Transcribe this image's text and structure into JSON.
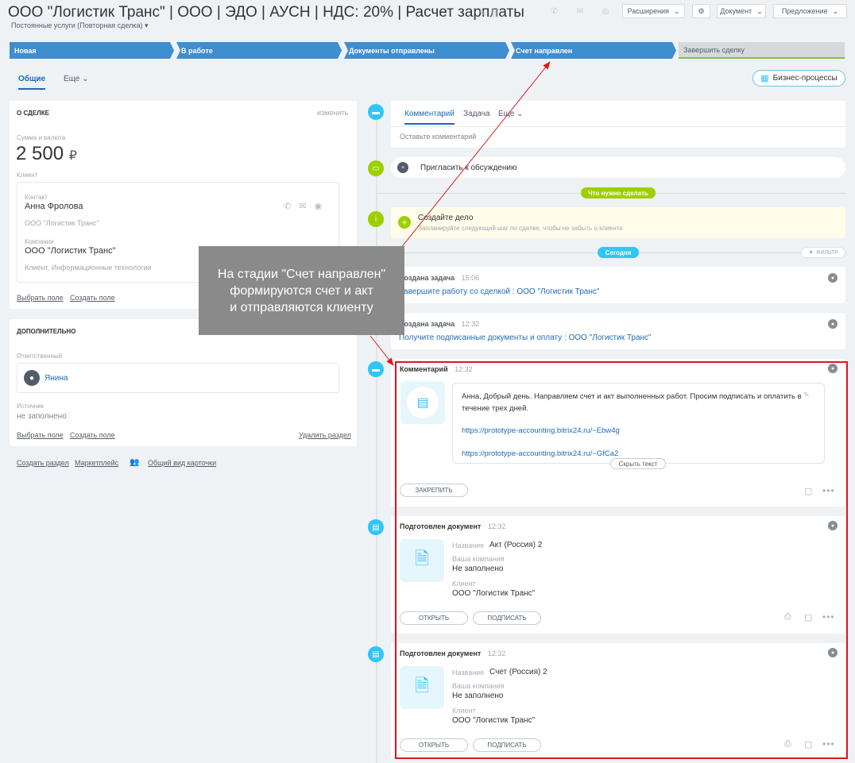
{
  "header": {
    "title": "ООО \"Логистик Транс\" | ООО | ЭДО | АУСН | НДС: 20% | Расчет зарплаты",
    "subtitle": "Постоянные услуги (Повторная сделка)",
    "extensions_label": "Расширения",
    "document_label": "Документ",
    "proposal_label": "Предложение"
  },
  "stages": [
    "Новая",
    "В работе",
    "Документы отправлены",
    "Счет направлен",
    "Завершить сделку"
  ],
  "tabs": {
    "general": "Общие",
    "more": "Еще"
  },
  "business_processes": "Бизнес-процессы",
  "about": {
    "title": "О СДЕЛКЕ",
    "edit": "изменить",
    "amount_label": "Сумма и валюта",
    "amount": "2 500",
    "currency": "₽",
    "client_label": "Клиент",
    "contact_label": "Контакт",
    "contact_name": "Анна Фролова",
    "contact_company": "ООО \"Логистик Транс\"",
    "company_label": "Компания",
    "company_name": "ООО \"Логистик Транс\"",
    "company_desc": "Клиент, Информационные технологии",
    "select_field": "Выбрать поле",
    "create_field": "Создать поле"
  },
  "extra": {
    "title": "ДОПОЛНИТЕЛЬНО",
    "responsible_label": "Ответственный",
    "responsible_name": "Янина",
    "source_label": "Источник",
    "source_value": "не заполнено",
    "select_field": "Выбрать поле",
    "create_field": "Создать поле",
    "delete_section": "Удалить раздел"
  },
  "bottom_links": {
    "create_section": "Создать раздел",
    "marketplace": "Маркетплейс",
    "common_view": "Общий вид карточки"
  },
  "composer": {
    "tab_comment": "Комментарий",
    "tab_task": "Задача",
    "tab_more": "Еще",
    "placeholder": "Оставьте комментарий"
  },
  "invite": "Пригласить к обсуждению",
  "todo_badge": "Что нужно сделать",
  "create_task": {
    "title": "Создайте дело",
    "hint": "Запланируйте следующий шаг по сделке, чтобы не забыть о клиенте"
  },
  "today_badge": "Сегодня",
  "filter_label": "ФИЛЬТР",
  "task1": {
    "label": "Создана задача",
    "time": "15:06",
    "text": "Завершите работу со сделкой : ООО \"Логистик Транс\""
  },
  "task2": {
    "label": "Создана задача",
    "time": "12:32",
    "text": "Получите подписанные документы и оплату : ООО \"Логистик Транс\""
  },
  "comment": {
    "label": "Комментарий",
    "time": "12:32",
    "text": "Анна, Добрый день. Направляем счет и акт выполненных работ. Просим подписать и оплатить в течение трех дней.",
    "link1": "https://prototype-accounting.bitrix24.ru/~Ebw4g",
    "link2": "https://prototype-accounting.bitrix24.ru/~GfCa2",
    "hide": "Скрыть текст",
    "pin": "ЗАКРЕПИТЬ"
  },
  "doc1": {
    "label": "Подготовлен документ",
    "time": "12:32",
    "name_label": "Название",
    "name": "Акт (Россия) 2",
    "company_label": "Ваша компания",
    "company": "Не заполнено",
    "client_label": "Клиент",
    "client": "ООО \"Логистик Транс\"",
    "open": "ОТКРЫТЬ",
    "sign": "ПОДПИСАТЬ"
  },
  "doc2": {
    "label": "Подготовлен документ",
    "time": "12:32",
    "name_label": "Название",
    "name": "Счет (Россия) 2",
    "company_label": "Ваша компания",
    "company": "Не заполнено",
    "client_label": "Клиент",
    "client": "ООО \"Логистик Транс\"",
    "open": "ОТКРЫТЬ",
    "sign": "ПОДПИСАТЬ"
  },
  "annotation": {
    "line1": "На стадии \"Счет направлен\"",
    "line2": "формируются счет и акт",
    "line3": "и отправляются клиенту"
  },
  "colors": {
    "stage_blue": "#3e8ed0",
    "accent_cyan": "#2fc6f6",
    "green": "#9dcf00",
    "red_box": "#e0151b"
  }
}
